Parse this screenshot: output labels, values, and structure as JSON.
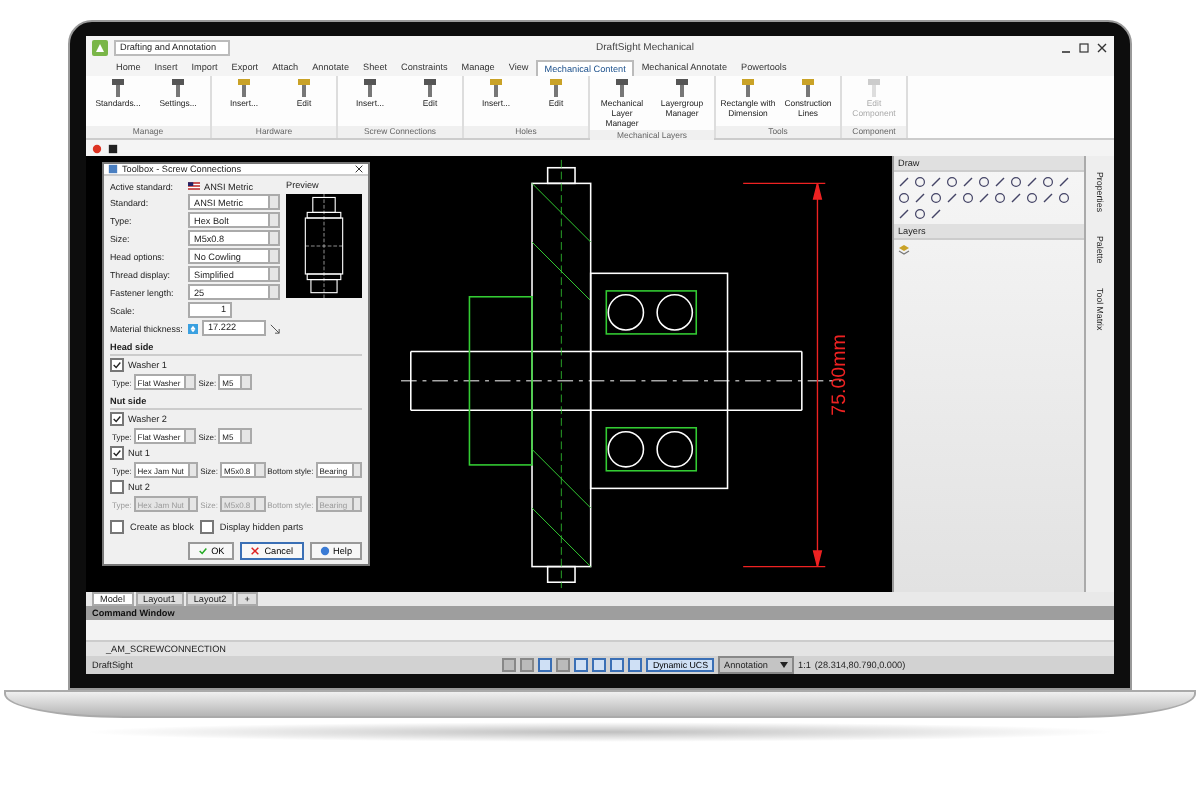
{
  "app": {
    "title": "DraftSight Mechanical",
    "workspace": "Drafting and Annotation"
  },
  "ribbon": {
    "tabs": [
      {
        "label": "Home",
        "selected": false
      },
      {
        "label": "Insert",
        "selected": false
      },
      {
        "label": "Import",
        "selected": false
      },
      {
        "label": "Export",
        "selected": false
      },
      {
        "label": "Attach",
        "selected": false
      },
      {
        "label": "Annotate",
        "selected": false
      },
      {
        "label": "Sheet",
        "selected": false
      },
      {
        "label": "Constraints",
        "selected": false
      },
      {
        "label": "Manage",
        "selected": false
      },
      {
        "label": "View",
        "selected": false
      },
      {
        "label": "Mechanical Content",
        "selected": true
      },
      {
        "label": "Mechanical Annotate",
        "selected": false
      },
      {
        "label": "Powertools",
        "selected": false
      }
    ],
    "groups": [
      {
        "label": "Manage",
        "tools": [
          {
            "label": "Standards...",
            "disabled": false
          },
          {
            "label": "Settings...",
            "disabled": false
          }
        ]
      },
      {
        "label": "Hardware",
        "tools": [
          {
            "label": "Insert...",
            "disabled": false
          },
          {
            "label": "Edit",
            "disabled": false
          }
        ]
      },
      {
        "label": "Screw Connections",
        "tools": [
          {
            "label": "Insert...",
            "disabled": false
          },
          {
            "label": "Edit",
            "disabled": false
          }
        ]
      },
      {
        "label": "Holes",
        "tools": [
          {
            "label": "Insert...",
            "disabled": false
          },
          {
            "label": "Edit",
            "disabled": false
          }
        ]
      },
      {
        "label": "Mechanical Layers",
        "tools": [
          {
            "label": "Mechanical Layer Manager",
            "disabled": false
          },
          {
            "label": "Layergroup Manager",
            "disabled": false
          }
        ]
      },
      {
        "label": "Tools",
        "tools": [
          {
            "label": "Rectangle with Dimension",
            "disabled": false
          },
          {
            "label": "Construction Lines",
            "disabled": false
          }
        ]
      },
      {
        "label": "Component",
        "tools": [
          {
            "label": "Edit Component",
            "disabled": true
          }
        ]
      }
    ]
  },
  "dialog": {
    "title": "Toolbox - Screw Connections",
    "active_standard_label": "Active standard:",
    "active_standard": "ANSI Metric",
    "preview_label": "Preview",
    "fields": [
      {
        "label": "Standard:",
        "value": "ANSI Metric",
        "kind": "dropdown"
      },
      {
        "label": "Type:",
        "value": "Hex Bolt",
        "kind": "dropdown"
      },
      {
        "label": "Size:",
        "value": "M5x0.8",
        "kind": "dropdown"
      },
      {
        "label": "Head options:",
        "value": "No Cowling",
        "kind": "dropdown"
      },
      {
        "label": "Thread display:",
        "value": "Simplified",
        "kind": "dropdown"
      },
      {
        "label": "Fastener length:",
        "value": "25",
        "kind": "dropdown"
      },
      {
        "label": "Scale:",
        "value": "1",
        "kind": "text"
      },
      {
        "label": "Material thickness:",
        "value": "17.222",
        "kind": "pick"
      }
    ],
    "sections": [
      {
        "title": "Head side",
        "parts": [
          {
            "label": "Washer 1",
            "checked": true,
            "fields": [
              {
                "label": "Type:",
                "value": "Flat Washer"
              },
              {
                "label": "Size:",
                "value": "M5"
              }
            ]
          }
        ]
      },
      {
        "title": "Nut side",
        "parts": [
          {
            "label": "Washer 2",
            "checked": true,
            "fields": [
              {
                "label": "Type:",
                "value": "Flat Washer"
              },
              {
                "label": "Size:",
                "value": "M5"
              }
            ]
          },
          {
            "label": "Nut 1",
            "checked": true,
            "fields": [
              {
                "label": "Type:",
                "value": "Hex Jam Nut"
              },
              {
                "label": "Size:",
                "value": "M5x0.8"
              },
              {
                "label": "Bottom style:",
                "value": "Bearing"
              }
            ]
          },
          {
            "label": "Nut 2",
            "checked": false,
            "fields": [
              {
                "label": "Type:",
                "value": "Hex Jam Nut"
              },
              {
                "label": "Size:",
                "value": "M5x0.8"
              },
              {
                "label": "Bottom style:",
                "value": "Bearing"
              }
            ]
          }
        ]
      }
    ],
    "options": [
      {
        "label": "Create as block",
        "checked": false
      },
      {
        "label": "Display hidden parts",
        "checked": false
      }
    ],
    "buttons": [
      {
        "label": "OK",
        "kind": "ok"
      },
      {
        "label": "Cancel",
        "kind": "cancel"
      },
      {
        "label": "Help",
        "kind": "help"
      }
    ]
  },
  "canvas": {
    "dimension": "75.00mm"
  },
  "panels": {
    "draw": "Draw",
    "layers": "Layers"
  },
  "side_tabs": [
    "Properties",
    "Palette",
    "Tool Matrix"
  ],
  "layout_tabs": [
    {
      "label": "Model",
      "selected": true
    },
    {
      "label": "Layout1",
      "selected": false
    },
    {
      "label": "Layout2",
      "selected": false
    }
  ],
  "new_tab": "+",
  "command": {
    "title": "Command Window",
    "history": "_AM_SCREWCONNECTION",
    "app_label": "DraftSight"
  },
  "status": {
    "toggles": [
      {
        "on": false
      },
      {
        "on": false
      },
      {
        "on": true
      },
      {
        "on": false
      },
      {
        "on": true
      },
      {
        "on": true
      },
      {
        "on": true
      },
      {
        "on": true
      }
    ],
    "dynamic_ucs": {
      "label": "Dynamic UCS",
      "on": true
    },
    "annotation": "Annotation",
    "scale": "1:1",
    "coordinates": "(28.314,80.790,0.000)"
  }
}
